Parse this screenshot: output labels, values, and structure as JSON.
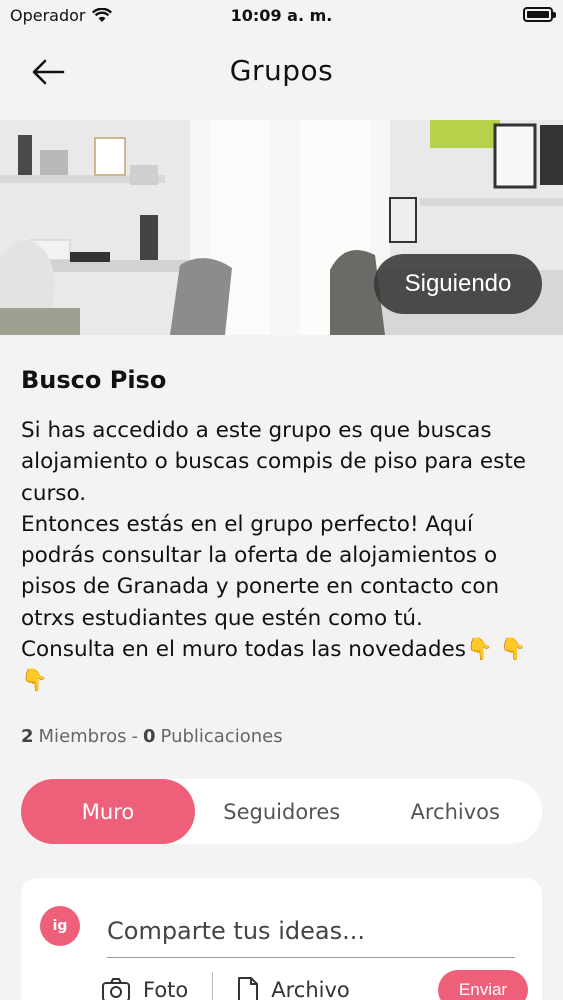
{
  "status_bar": {
    "carrier": "Operador",
    "time": "10:09 a. m."
  },
  "nav": {
    "title": "Grupos"
  },
  "banner": {
    "follow_label": "Siguiendo"
  },
  "group": {
    "title": "Busco Piso",
    "description": "Si has accedido a este grupo es que buscas alojamiento o buscas compis de piso para este curso.\nEntonces estás en el grupo perfecto! Aquí podrás consultar la oferta de alojamientos o pisos de Granada y ponerte en contacto con otrxs estudiantes que estén como tú.\nConsulta en el muro todas las novedades👇 👇 👇",
    "members_count": "2",
    "members_label": "Miembros",
    "separator": "-",
    "posts_count": "0",
    "posts_label": "Publicaciones"
  },
  "tabs": [
    {
      "label": "Muro",
      "active": true
    },
    {
      "label": "Seguidores",
      "active": false
    },
    {
      "label": "Archivos",
      "active": false
    }
  ],
  "composer": {
    "avatar_text": "ig",
    "placeholder": "Comparte tus ideas...",
    "photo_label": "Foto",
    "file_label": "Archivo",
    "send_label": "Enviar"
  },
  "colors": {
    "accent": "#ee6079",
    "background": "#f4f3f4"
  }
}
